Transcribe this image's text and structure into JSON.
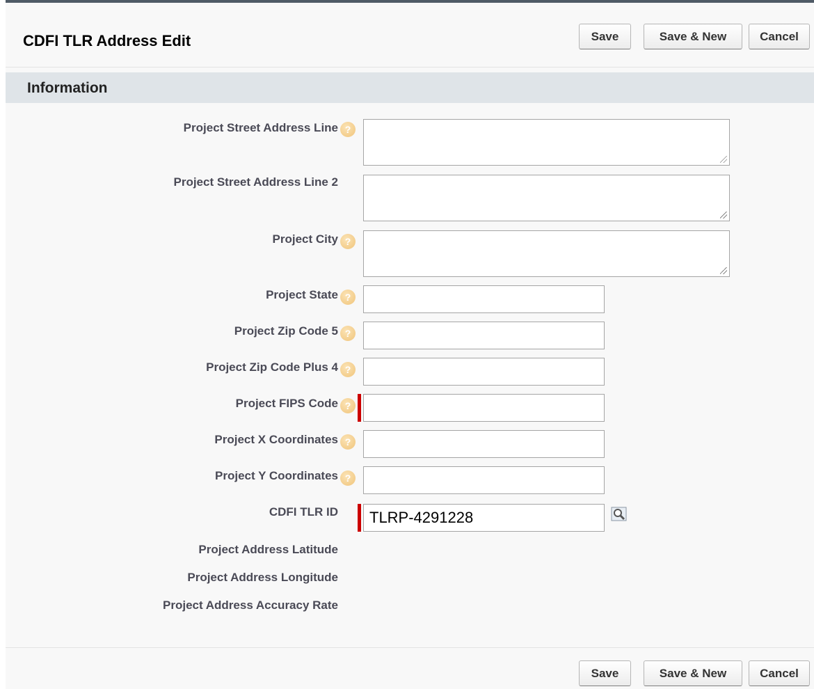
{
  "header": {
    "title": "CDFI TLR Address Edit",
    "buttons": {
      "save": "Save",
      "save_new": "Save & New",
      "cancel": "Cancel"
    }
  },
  "section": {
    "title": "Information"
  },
  "fields": {
    "street1": {
      "label": "Project Street Address Line",
      "value": ""
    },
    "street2": {
      "label": "Project Street Address Line 2",
      "value": ""
    },
    "city": {
      "label": "Project City",
      "value": ""
    },
    "state": {
      "label": "Project State",
      "value": ""
    },
    "zip5": {
      "label": "Project Zip Code 5",
      "value": ""
    },
    "zip4": {
      "label": "Project Zip Code Plus 4",
      "value": ""
    },
    "fips": {
      "label": "Project FIPS Code",
      "value": ""
    },
    "xcoord": {
      "label": "Project X Coordinates",
      "value": ""
    },
    "ycoord": {
      "label": "Project Y Coordinates",
      "value": ""
    },
    "tlr_id": {
      "label": "CDFI TLR ID",
      "value": "TLRP-4291228"
    },
    "latitude": {
      "label": "Project Address Latitude"
    },
    "longitude": {
      "label": "Project Address Longitude"
    },
    "accuracy": {
      "label": "Project Address Accuracy Rate"
    }
  },
  "footer": {
    "buttons": {
      "save": "Save",
      "save_new": "Save & New",
      "cancel": "Cancel"
    }
  },
  "icons": {
    "help": "help-icon",
    "lookup": "lookup-icon"
  },
  "colors": {
    "required": "#cc0000",
    "section_bg": "#dfe4e8",
    "top_border": "#4f5b66"
  }
}
